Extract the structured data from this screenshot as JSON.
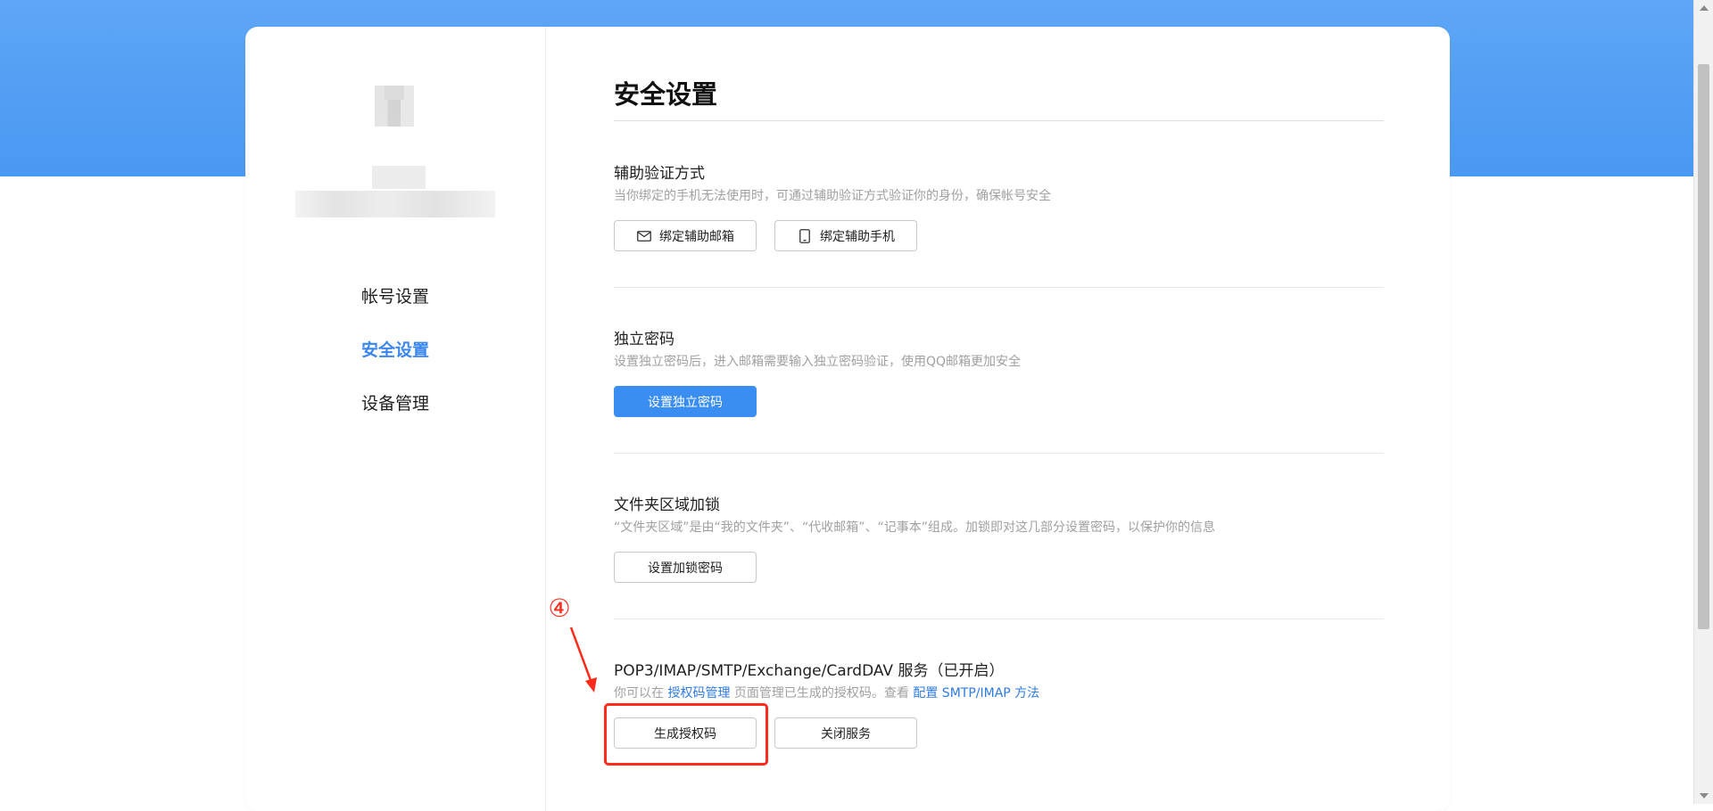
{
  "sidebar": {
    "items": [
      {
        "label": "帐号设置",
        "active": false
      },
      {
        "label": "安全设置",
        "active": true
      },
      {
        "label": "设备管理",
        "active": false
      }
    ]
  },
  "main": {
    "title": "安全设置",
    "sections": [
      {
        "title": "辅助验证方式",
        "desc": "当你绑定的手机无法使用时，可通过辅助验证方式验证你的身份，确保帐号安全",
        "buttons": [
          {
            "label": "绑定辅助邮箱",
            "icon": "mail-icon"
          },
          {
            "label": "绑定辅助手机",
            "icon": "phone-icon"
          }
        ]
      },
      {
        "title": "独立密码",
        "desc": "设置独立密码后，进入邮箱需要输入独立密码验证，使用QQ邮箱更加安全",
        "buttons": [
          {
            "label": "设置独立密码",
            "primary": true
          }
        ]
      },
      {
        "title": "文件夹区域加锁",
        "desc": "“文件夹区域”是由“我的文件夹”、“代收邮箱”、“记事本”组成。加锁即对这几部分设置密码，以保护你的信息",
        "buttons": [
          {
            "label": "设置加锁密码"
          }
        ]
      },
      {
        "title": "POP3/IMAP/SMTP/Exchange/CardDAV 服务（已开启）",
        "desc_prefix": "你可以在 ",
        "desc_link1": "授权码管理",
        "desc_mid": " 页面管理已生成的授权码。查看 ",
        "desc_link2": "配置 SMTP/IMAP 方法",
        "buttons": [
          {
            "label": "生成授权码"
          },
          {
            "label": "关闭服务"
          }
        ]
      }
    ]
  },
  "annotation": {
    "step_marker": "④",
    "color": "#ff2a1a"
  },
  "colors": {
    "banner": "#4a98f2",
    "accent": "#3a8ef2",
    "link": "#2d7be5"
  }
}
